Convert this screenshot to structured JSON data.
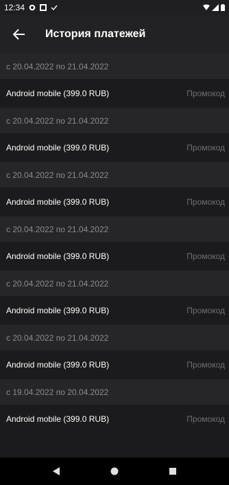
{
  "status_bar": {
    "time": "12:34",
    "icons_left": [
      "settings-icon",
      "square-icon",
      "check-icon"
    ],
    "icons_right": [
      "wifi-icon",
      "signal-icon",
      "battery-icon"
    ]
  },
  "header": {
    "title": "История платежей",
    "back_icon": "arrow-left-icon"
  },
  "payments": [
    {
      "period": "с 20.04.2022 по 21.04.2022",
      "name": "Android mobile (399.0 RUB)",
      "type": "Промокод"
    },
    {
      "period": "с 20.04.2022 по 21.04.2022",
      "name": "Android mobile (399.0 RUB)",
      "type": "Промокод"
    },
    {
      "period": "с 20.04.2022 по 21.04.2022",
      "name": "Android mobile (399.0 RUB)",
      "type": "Промокод"
    },
    {
      "period": "с 20.04.2022 по 21.04.2022",
      "name": "Android mobile (399.0 RUB)",
      "type": "Промокод"
    },
    {
      "period": "с 20.04.2022 по 21.04.2022",
      "name": "Android mobile (399.0 RUB)",
      "type": "Промокод"
    },
    {
      "period": "с 20.04.2022 по 21.04.2022",
      "name": "Android mobile (399.0 RUB)",
      "type": "Промокод"
    },
    {
      "period": "с 19.04.2022 по 20.04.2022",
      "name": "Android mobile (399.0 RUB)",
      "type": "Промокод"
    }
  ],
  "nav_bar": {
    "icons": [
      "back-triangle-icon",
      "home-circle-icon",
      "recents-square-icon"
    ]
  },
  "colors": {
    "background": "#1b1b1d",
    "period_row": "#262629",
    "app_bar": "#222224",
    "period_text": "#8a8c93",
    "type_text": "#6d6f76"
  }
}
